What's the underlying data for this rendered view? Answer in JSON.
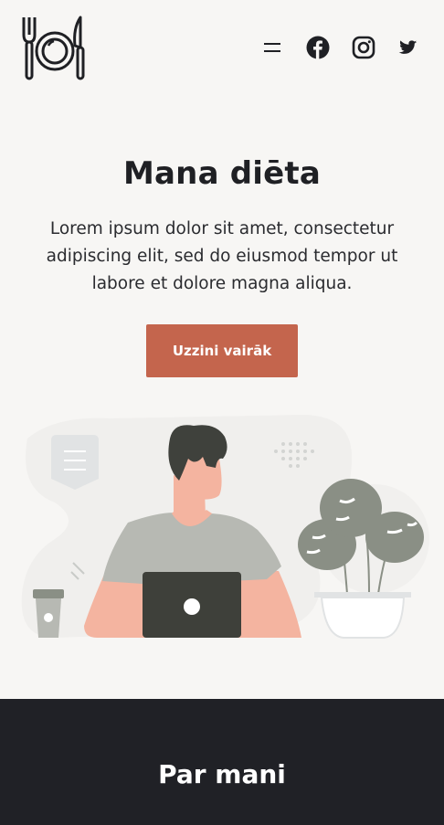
{
  "header": {
    "logo": "plate-fork-knife-logo",
    "icons": [
      "menu-icon",
      "facebook-icon",
      "instagram-icon",
      "twitter-icon"
    ]
  },
  "hero": {
    "title": "Mana diēta",
    "description": "Lorem ipsum dolor sit amet, consectetur adipiscing elit, sed do eiusmod tempor ut labore et dolore magna aliqua.",
    "button_label": "Uzzini vairāk"
  },
  "about": {
    "title": "Par mani"
  },
  "colors": {
    "background": "#f7f6f4",
    "accent": "#c4654d",
    "dark": "#202126",
    "plant": "#8a8f85",
    "shirt": "#b7b9b3",
    "skin": "#f4b4a0"
  }
}
